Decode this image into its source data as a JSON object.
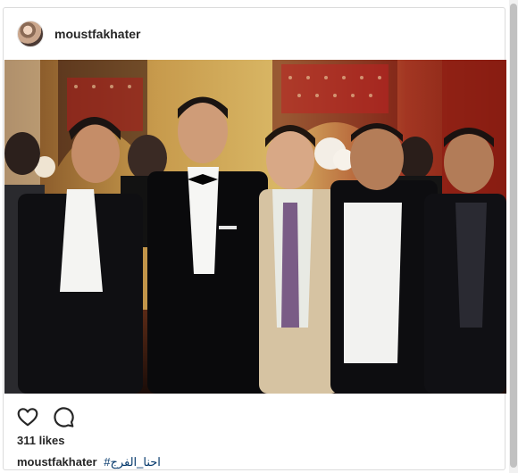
{
  "post": {
    "username": "moustfakhater",
    "likes_text": "311 likes",
    "caption_user": "moustfakhater",
    "caption_text": "#احنا_الفرج"
  },
  "icons": {
    "like": "heart-icon",
    "comment": "comment-icon"
  },
  "colors": {
    "border": "#dbdbdb",
    "text": "#262626",
    "hashtag": "#003569"
  }
}
